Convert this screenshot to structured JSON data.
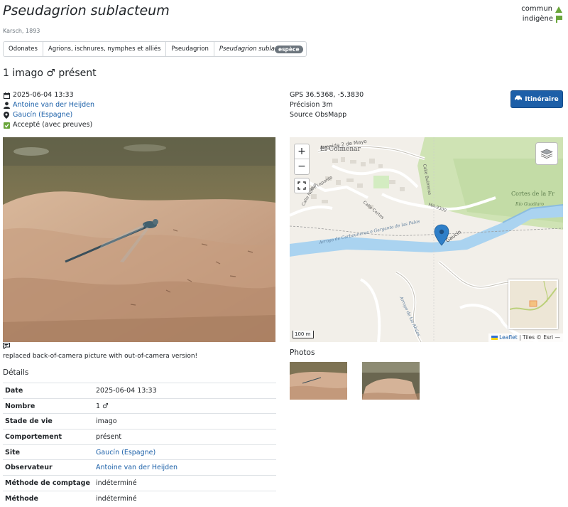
{
  "species": {
    "name": "Pseudagrion sublacteum",
    "author": "Karsch, 1893"
  },
  "status": {
    "abundance": "commun",
    "origin": "indigène"
  },
  "breadcrumb": [
    {
      "label": "Odonates"
    },
    {
      "label": "Agrions, ischnures, nymphes et alliés"
    },
    {
      "label": "Pseudagrion"
    },
    {
      "label": "Pseudagrion sublacteum"
    }
  ],
  "rank_badge": "espèce",
  "headline": "1 imago ♂ présent",
  "observation": {
    "datetime": "2025-06-04 13:33",
    "observer": "Antoine van der Heijden",
    "site": "Gaucín (Espagne)",
    "validation": "Accepté (avec preuves)"
  },
  "gps": {
    "label": "GPS",
    "coords": "36.5368, -5.3830",
    "precision_label": "Précision",
    "precision": "3m",
    "source_label": "Source",
    "source": "ObsMapp"
  },
  "route_button": "Itinéraire",
  "comment": "replaced back-of-camera picture with out-of-camera version!",
  "details": {
    "title": "Détails",
    "rows": [
      {
        "key": "Date",
        "value": "2025-06-04 13:33",
        "link": false
      },
      {
        "key": "Nombre",
        "value": "1 ♂",
        "link": false
      },
      {
        "key": "Stade de vie",
        "value": "imago",
        "link": false
      },
      {
        "key": "Comportement",
        "value": "présent",
        "link": false
      },
      {
        "key": "Site",
        "value": "Gaucín (Espagne)",
        "link": true
      },
      {
        "key": "Observateur",
        "value": "Antoine van der Heijden",
        "link": true
      },
      {
        "key": "Méthode de comptage",
        "value": "indéterminé",
        "link": false
      },
      {
        "key": "Méthode",
        "value": "indéterminé",
        "link": false
      }
    ]
  },
  "map": {
    "zoom_in": "+",
    "zoom_out": "−",
    "scale": "100 m",
    "attribution_leaflet": "Leaflet",
    "attribution_tiles": "| Tiles © Esri —",
    "labels": {
      "town": "El Colmenar",
      "river": "Río Guadiaro",
      "place": "Cortes de la Fr",
      "street1": "Avenida 2 de Mayo",
      "street2": "Calle Buitreras",
      "street3": "Calle Lepanto",
      "street4": "Calle Nueva",
      "street5": "Calle Cortes",
      "road": "MA-9300",
      "gaucin": "Gaucín",
      "arroyo": "Arroyo de Carbouneras o Garganta de las Palas",
      "arroyo2": "Arroyo de las Ahúas"
    }
  },
  "photos_title": "Photos",
  "colors": {
    "accent": "#1d5fa8",
    "link": "#1a5fa8",
    "status_green": "#6aa63b",
    "badge": "#6c757d"
  }
}
